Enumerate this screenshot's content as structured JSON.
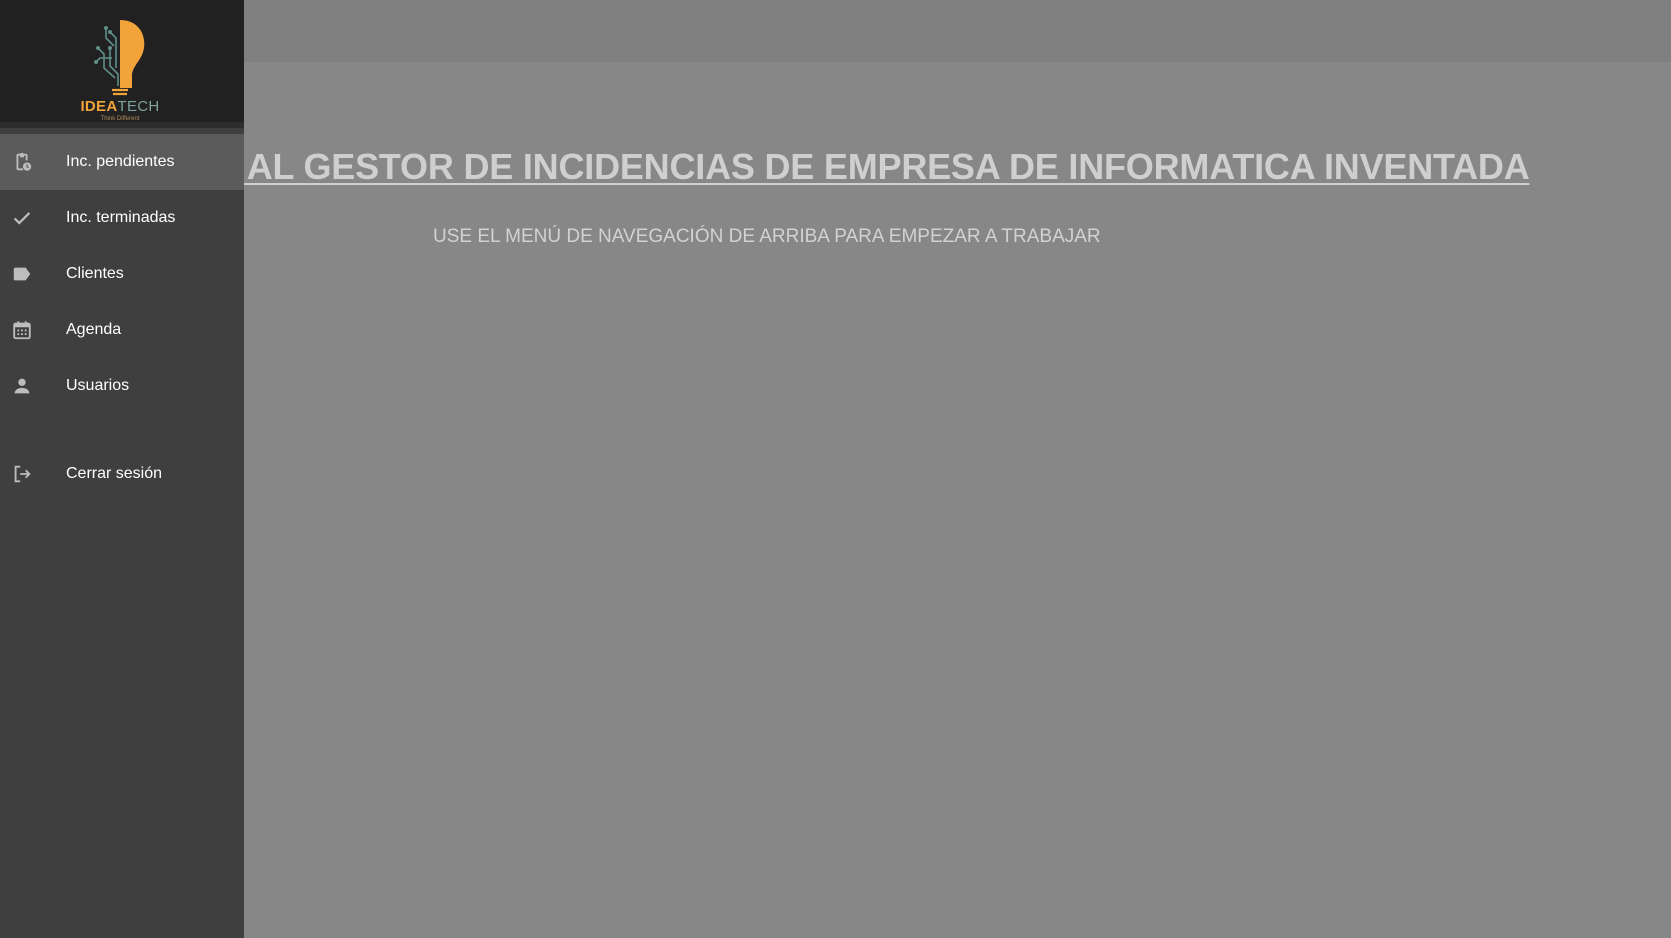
{
  "app": {
    "brand_primary": "IDEA",
    "brand_secondary": "TECH",
    "tagline": "Think Different"
  },
  "main": {
    "title": "O AL GESTOR DE INCIDENCIAS DE EMPRESA DE INFORMATICA INVENTADA",
    "subtitle": "USE EL MENÚ DE NAVEGACIÓN DE ARRIBA PARA EMPEZAR A TRABAJAR"
  },
  "sidebar": {
    "items": [
      {
        "label": "Inc. pendientes",
        "icon": "clipboard-clock-icon",
        "active": true
      },
      {
        "label": "Inc. terminadas",
        "icon": "check-icon",
        "active": false
      },
      {
        "label": "Clientes",
        "icon": "label-tag-icon",
        "active": false
      },
      {
        "label": "Agenda",
        "icon": "calendar-icon",
        "active": false
      },
      {
        "label": "Usuarios",
        "icon": "person-icon",
        "active": false
      }
    ],
    "logout": {
      "label": "Cerrar sesión",
      "icon": "logout-icon"
    }
  },
  "colors": {
    "drawer_bg": "#3f3f3f",
    "drawer_header_bg": "#212121",
    "active_item_bg": "#5b5b5b",
    "overlay_bg": "#878787",
    "brand_orange": "#f2a33a",
    "brand_teal": "#7fa39a"
  }
}
